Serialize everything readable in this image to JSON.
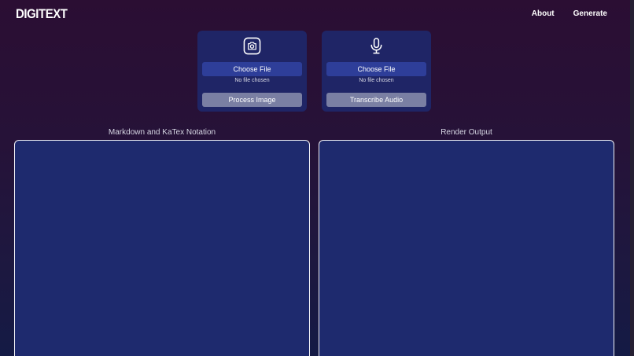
{
  "header": {
    "logo": "DIGITEXT",
    "nav": [
      "About",
      "Generate"
    ]
  },
  "image_card": {
    "icon": "camera-icon",
    "choose_label": "Choose File",
    "file_status": "No file chosen",
    "action_label": "Process Image"
  },
  "audio_card": {
    "icon": "microphone-icon",
    "choose_label": "Choose File",
    "file_status": "No file chosen",
    "action_label": "Transcribe Audio"
  },
  "editor": {
    "left_label": "Markdown and KaTex Notation",
    "right_label": "Render Output",
    "input_value": "",
    "output_value": ""
  },
  "colors": {
    "card_bg": "#1f2566",
    "choose_btn": "#2e3e99",
    "action_btn": "#7a7fa3",
    "panel_bg": "#1e2a6e"
  }
}
